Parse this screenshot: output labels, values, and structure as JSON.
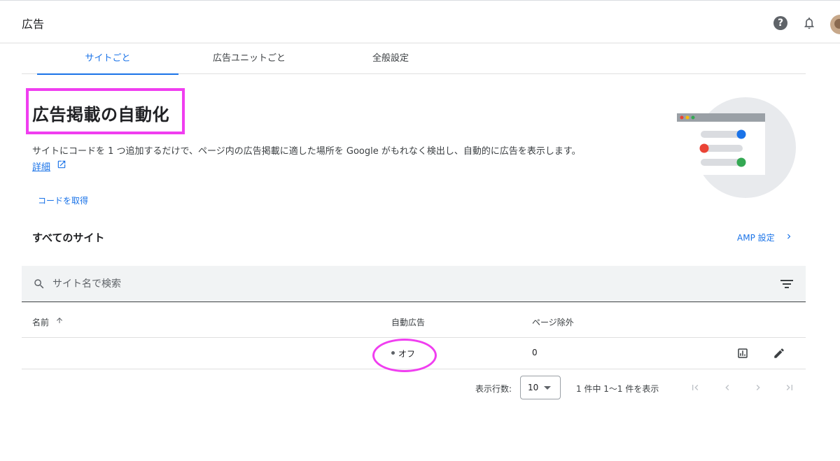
{
  "app": {
    "title": "広告"
  },
  "tabs": [
    {
      "label": "サイトごと",
      "active": true
    },
    {
      "label": "広告ユニットごと",
      "active": false
    },
    {
      "label": "全般設定",
      "active": false
    }
  ],
  "intro": {
    "headline": "広告掲載の自動化",
    "description": "サイトにコードを 1 つ追加するだけで、ページ内の広告掲載に適した場所を Google がもれなく検出し、自動的に広告を表示します。",
    "learn_more": "詳細",
    "get_code": "コードを取得"
  },
  "sites": {
    "heading": "すべてのサイト",
    "amp_link": "AMP 設定",
    "search_placeholder": "サイト名で検索",
    "columns": [
      "名前",
      "自動広告",
      "ページ除外"
    ],
    "rows": [
      {
        "name": "",
        "auto_ads": "オフ",
        "page_exclusions": "0"
      }
    ]
  },
  "pagination": {
    "rows_label": "表示行数:",
    "rows_value": "10",
    "range": "1 件中 1〜1 件を表示"
  },
  "colors": {
    "accent": "#1a73e8",
    "highlight": "#f03ef0"
  }
}
